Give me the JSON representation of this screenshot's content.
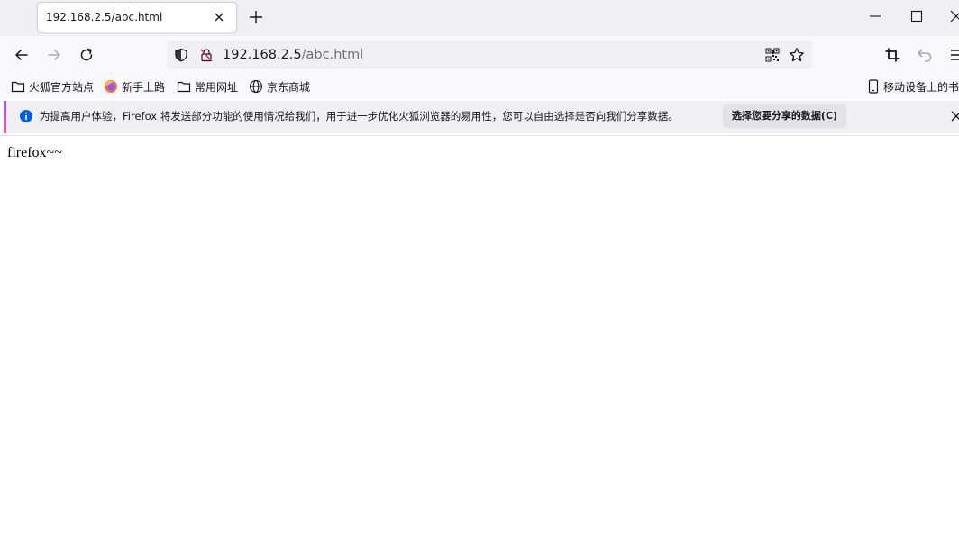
{
  "colors": {
    "titlebar_bg": "#f0f0f4",
    "toolbar_bg": "#f9f9fb",
    "info_accent": "#0060df",
    "insecure_lock": "#e22850"
  },
  "tabs": [
    {
      "title": "192.168.2.5/abc.html",
      "active": true
    }
  ],
  "urlbar": {
    "host": "192.168.2.5",
    "path": "/abc.html"
  },
  "bookmarks": [
    {
      "label": "火狐官方站点",
      "icon": "folder-icon"
    },
    {
      "label": "新手上路",
      "icon": "firefox-icon"
    },
    {
      "label": "常用网址",
      "icon": "folder-icon"
    },
    {
      "label": "京东商城",
      "icon": "globe-icon"
    }
  ],
  "mobile_bookmarks": {
    "label": "移动设备上的书签",
    "icon": "mobile-device-icon"
  },
  "infobar": {
    "message": "为提高用户体验，Firefox 将发送部分功能的使用情况给我们，用于进一步优化火狐浏览器的易用性，您可以自由选择是否向我们分享数据。",
    "button_label": "选择您要分享的数据(C)"
  },
  "page": {
    "text": "firefox~~"
  }
}
